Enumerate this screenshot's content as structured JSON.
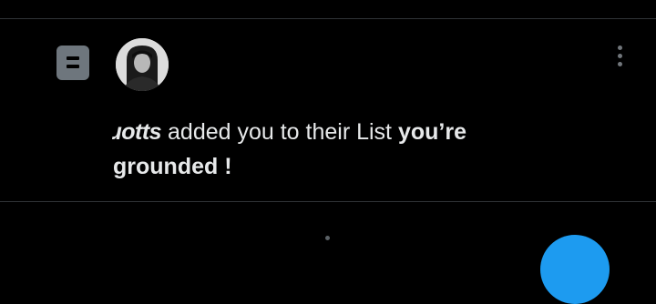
{
  "notification": {
    "type_icon": "list-icon",
    "avatar_icon": "profile-avatar",
    "more_icon": "more-vertical-icon",
    "username": "ɹotts",
    "action_text": " added you to their List ",
    "list_name": "you’re grounded !"
  },
  "colors": {
    "background": "#000000",
    "divider": "#2f3336",
    "text": "#e7e9ea",
    "icon_gray": "#6e767d",
    "accent": "#1d9bf0"
  },
  "fab": {
    "icon": "compose-fab-icon"
  }
}
